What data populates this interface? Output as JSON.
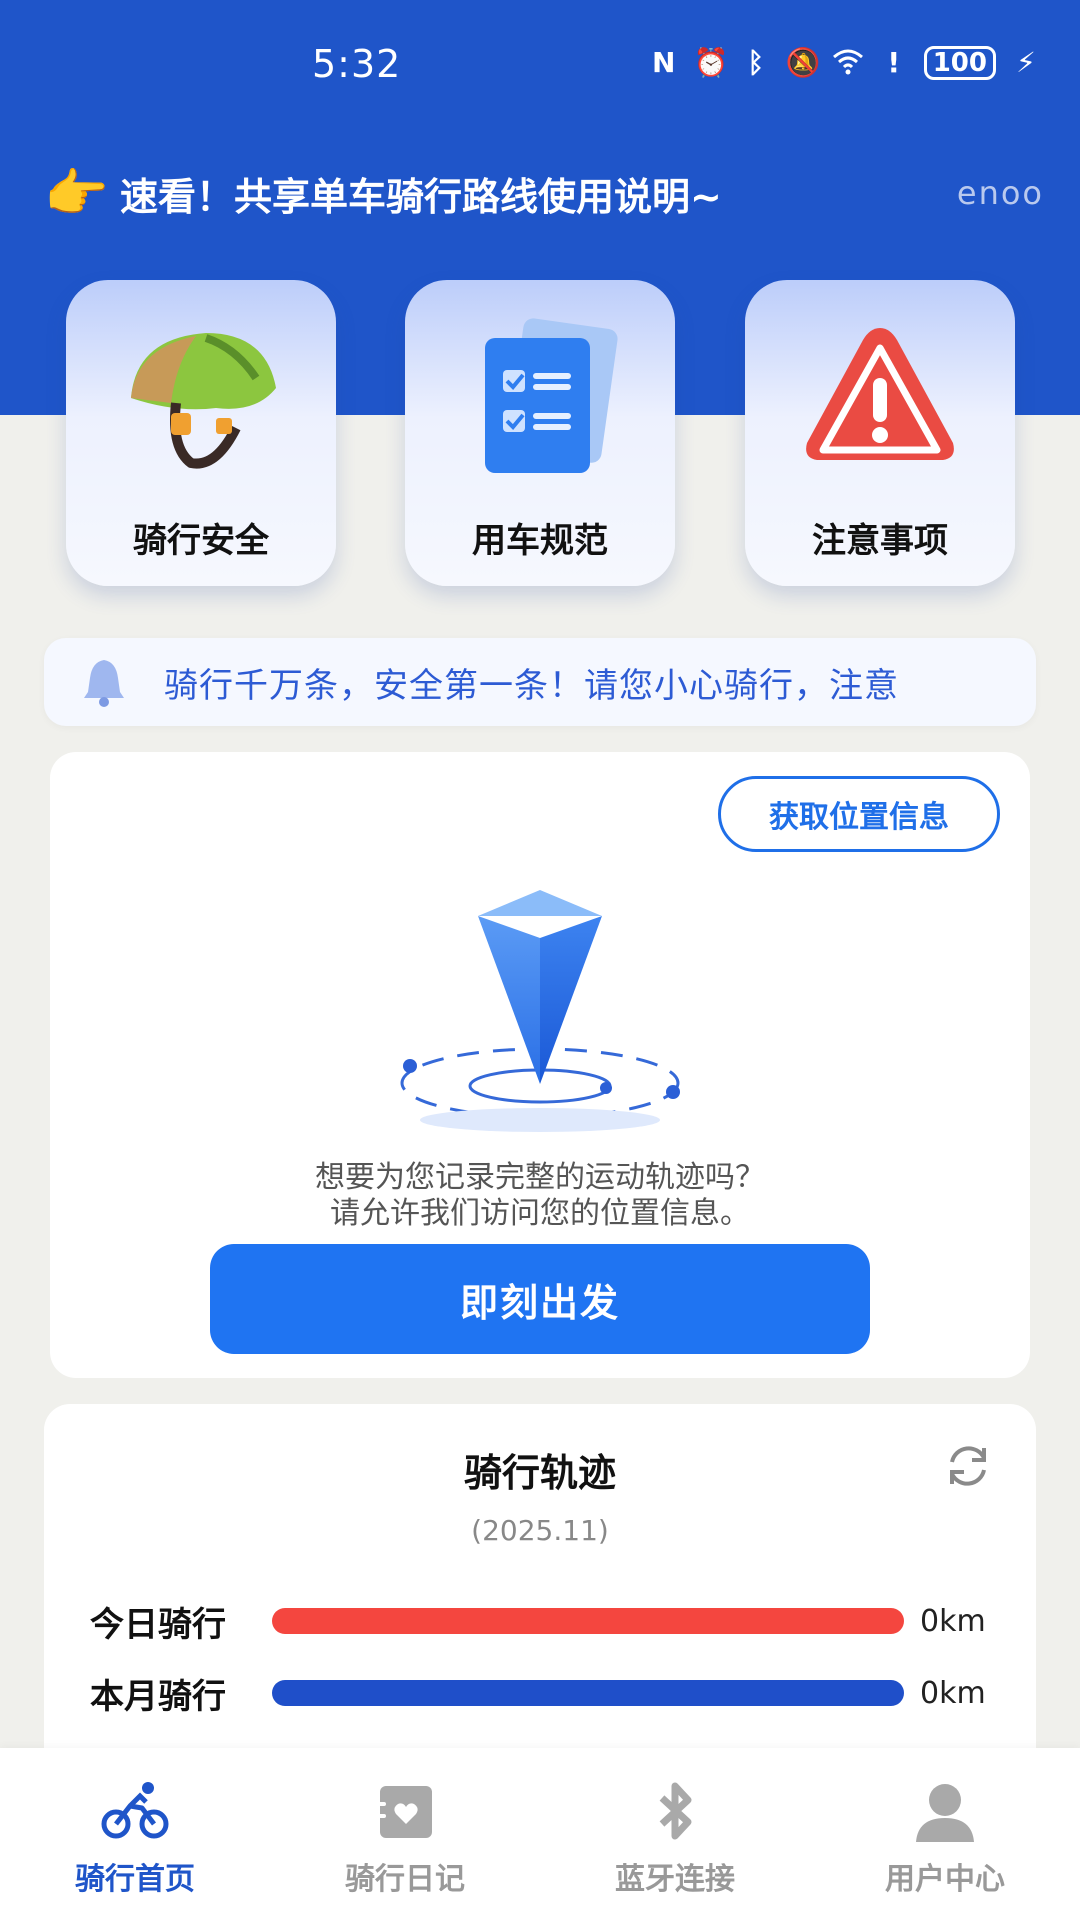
{
  "status_bar": {
    "time": "5:32",
    "battery": "100",
    "icons": [
      "nfc-icon",
      "alarm-icon",
      "bluetooth-icon",
      "mute-icon",
      "wifi-icon",
      "alert-icon",
      "charging-icon"
    ]
  },
  "header": {
    "announcement": "速看！共享单车骑行路线使用说明~",
    "brand": "enoo"
  },
  "features": [
    {
      "label": "骑行安全",
      "icon": "helmet-icon"
    },
    {
      "label": "用车规范",
      "icon": "checklist-icon"
    },
    {
      "label": "注意事项",
      "icon": "warning-icon"
    }
  ],
  "notice": {
    "text": "骑行千万条，安全第一条！请您小心骑行，注意"
  },
  "location": {
    "button_label": "获取位置信息",
    "prompt_line1": "想要为您记录完整的运动轨迹吗？",
    "prompt_line2": "请允许我们访问您的位置信息。",
    "go_label": "即刻出发"
  },
  "track": {
    "title": "骑行轨迹",
    "date": "(2025.11)",
    "stats": [
      {
        "label": "今日骑行",
        "value": "0km",
        "color": "#f4463f"
      },
      {
        "label": "本月骑行",
        "value": "0km",
        "color": "#1f4fc9"
      }
    ]
  },
  "nav": {
    "items": [
      {
        "label": "骑行首页",
        "active": true
      },
      {
        "label": "骑行日记",
        "active": false
      },
      {
        "label": "蓝牙连接",
        "active": false
      },
      {
        "label": "用户中心",
        "active": false
      }
    ]
  },
  "colors": {
    "brand_blue": "#1f55c9",
    "accent_blue": "#1f74f2"
  }
}
